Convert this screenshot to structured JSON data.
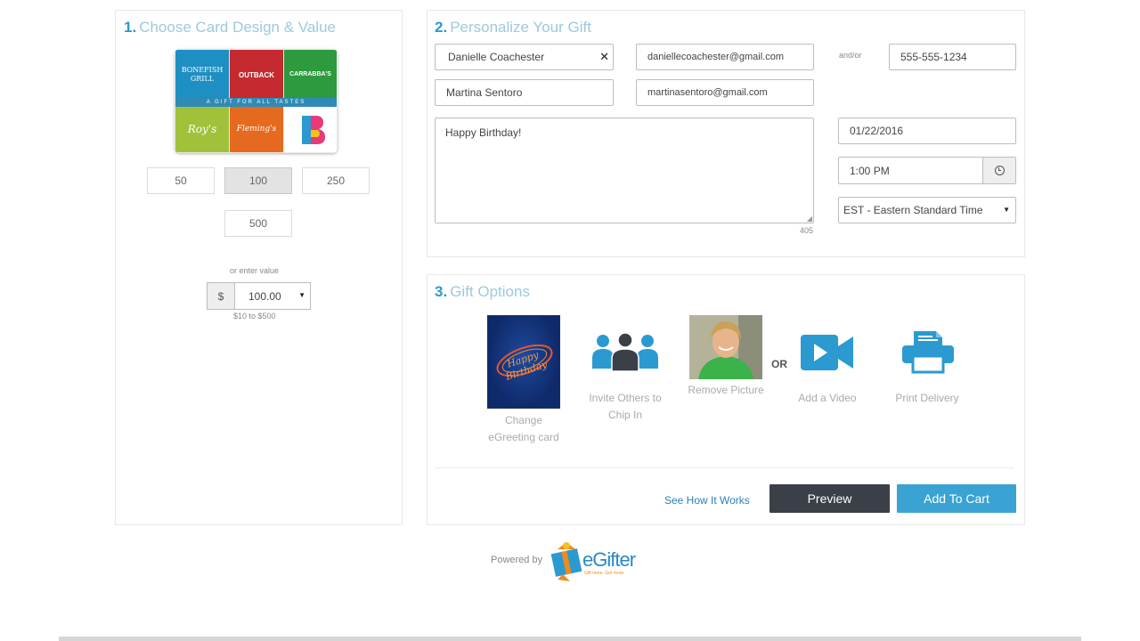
{
  "section1": {
    "number": "1.",
    "title": "Choose Card Design & Value",
    "card_tiles": [
      {
        "label": "BONEFISH GRILL",
        "color": "#1e8fc2"
      },
      {
        "label": "OUTBACK",
        "color": "#c42a2f"
      },
      {
        "label": "CARRABBA'S",
        "color": "#2e9a3e"
      },
      {
        "label": "Roy's",
        "color": "#9fc23a"
      },
      {
        "label": "Fleming's",
        "color": "#e56a1f"
      },
      {
        "label": "B",
        "color": "#ffffff"
      }
    ],
    "card_banner": "A GIFT FOR ALL TASTES",
    "amounts": [
      "50",
      "100",
      "250",
      "500"
    ],
    "selected_amount": "100",
    "enter_value_label": "or enter value",
    "currency_symbol": "$",
    "custom_value": "100.00",
    "range_hint": "$10 to $500"
  },
  "section2": {
    "number": "2.",
    "title": "Personalize Your Gift",
    "recipient_name": "Danielle Coachester",
    "recipient_email": "daniellecoachester@gmail.com",
    "andor_label": "and/or",
    "recipient_phone": "555-555-1234",
    "sender_name": "Martina Sentoro",
    "sender_email": "martinasentoro@gmail.com",
    "message": "Happy Birthday!",
    "char_count": "405",
    "date": "01/22/2016",
    "time": "1:00 PM",
    "timezone": "EST - Eastern Standard Time"
  },
  "section3": {
    "number": "3.",
    "title": "Gift Options",
    "options": [
      {
        "label": "Change eGreeting card",
        "icon": "greeting-card-birthday"
      },
      {
        "label": "Invite Others to Chip In",
        "icon": "group-icon"
      },
      {
        "label": "Remove Picture",
        "icon": "photo"
      },
      {
        "label": "Add a Video",
        "icon": "video-camera-icon"
      },
      {
        "label": "Print Delivery",
        "icon": "printer-icon"
      }
    ],
    "or_label": "OR",
    "greeting_text": "Happy Birthday",
    "see_how_label": "See How It Works",
    "preview_label": "Preview",
    "add_to_cart_label": "Add To Cart"
  },
  "footer": {
    "powered_by": "Powered by",
    "brand": "eGifter",
    "tagline": "Gift more. Get more."
  },
  "colors": {
    "accent": "#2a9ad1",
    "icon_blue": "#2a9ad1",
    "preview_btn": "#3a3f48",
    "cart_btn": "#3aa3d3"
  }
}
